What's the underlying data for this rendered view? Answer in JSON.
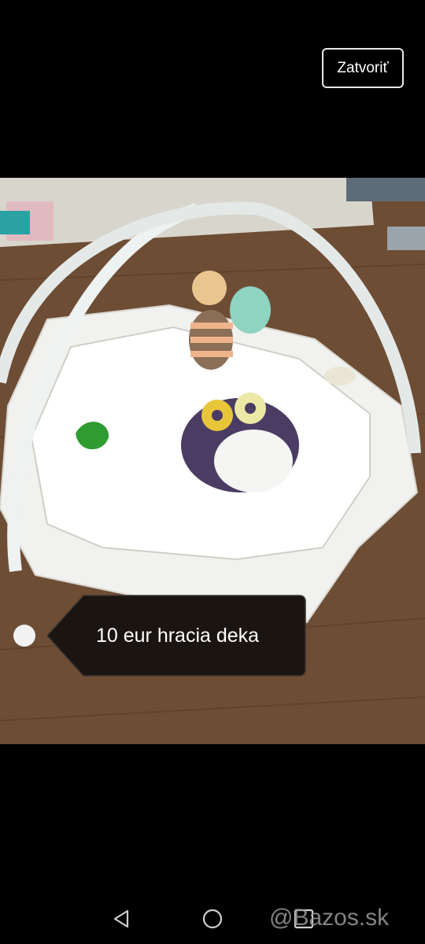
{
  "header": {
    "close_label": "Zatvoriť"
  },
  "caption": {
    "text": "10 eur hracia deka"
  },
  "photo": {
    "subject": "play-mat-photo"
  },
  "watermark": {
    "text": "@Bazos.sk"
  },
  "nav": {
    "icons": [
      "back-icon",
      "home-icon",
      "recents-icon"
    ]
  },
  "colors": {
    "background": "#000000",
    "bubble": "#1a1511",
    "text": "#ffffff"
  }
}
